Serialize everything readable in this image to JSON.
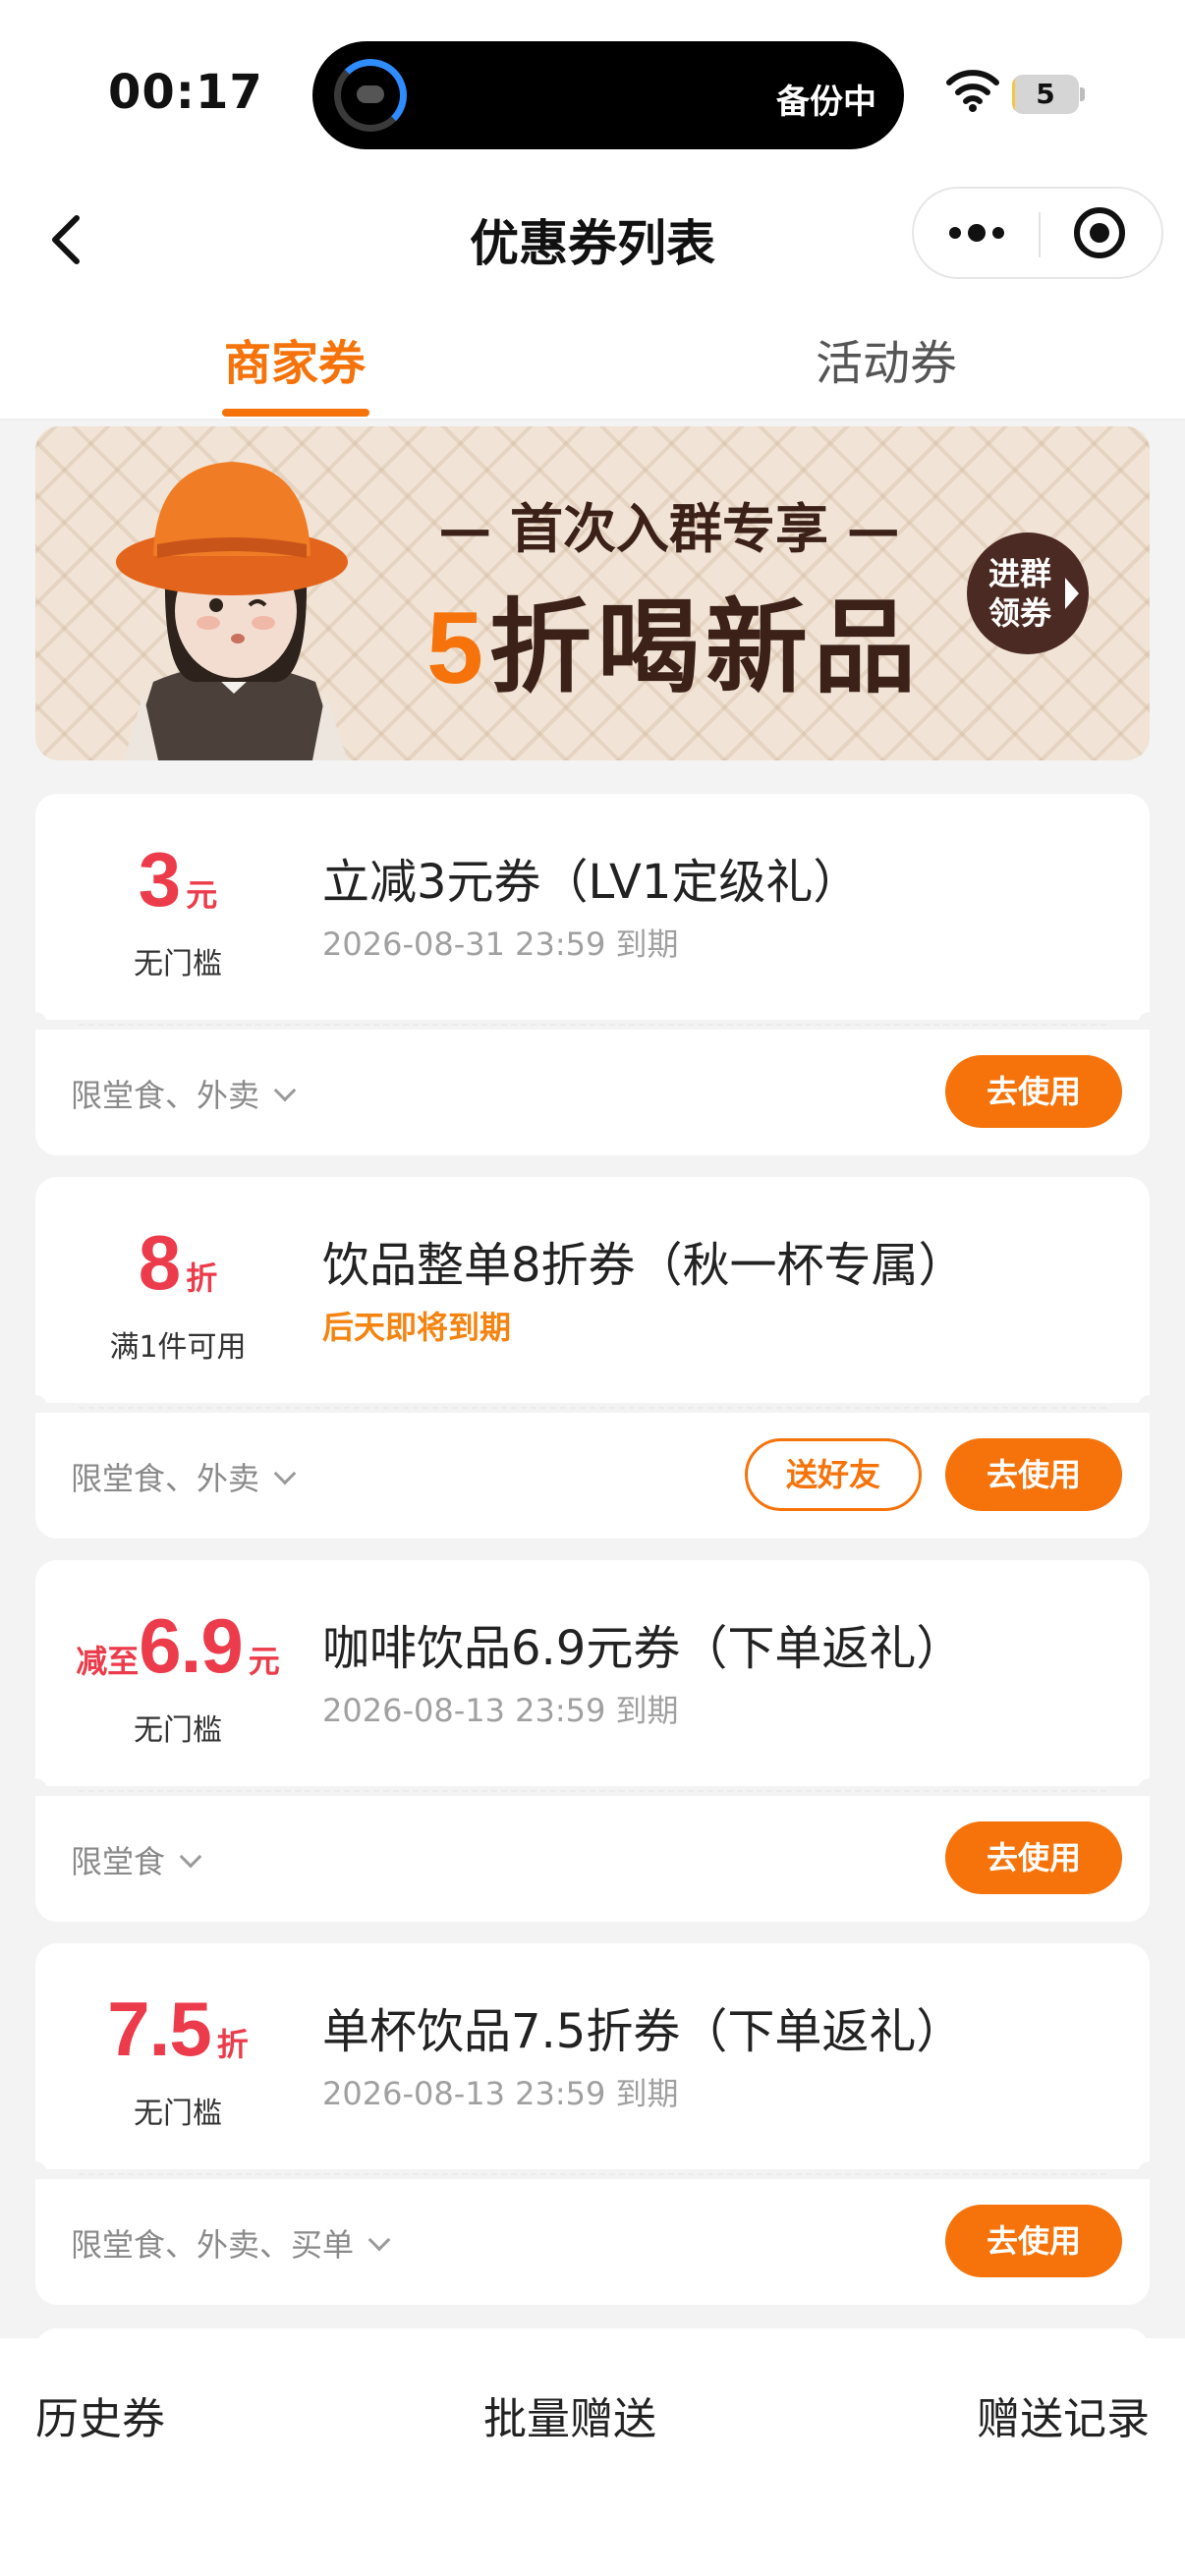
{
  "status_bar": {
    "time": "00:17",
    "island_text": "备份中",
    "battery_level": 5,
    "battery_percent": 0.05
  },
  "nav": {
    "title": "优惠券列表",
    "icons": {
      "back": "chevron-left-icon",
      "more": "more-dots-icon",
      "close": "target-circle-icon"
    }
  },
  "tabs": [
    {
      "label": "商家券",
      "active": true
    },
    {
      "label": "活动券",
      "active": false
    }
  ],
  "banner": {
    "subtitle": "— 首次入群专享 —",
    "title_num": "5",
    "title_rest": "折喝新品",
    "join_button": "进群领券"
  },
  "coupons": [
    {
      "value_prefix": "",
      "value": "3",
      "unit": "元",
      "threshold": "无门槛",
      "title": "立减3元券（LV1定级礼）",
      "expiry": "2026-08-31 23:59 到期",
      "expiry_warn": false,
      "scope": "限堂食、外卖",
      "gift_button": "",
      "use_button": "去使用"
    },
    {
      "value_prefix": "",
      "value": "8",
      "unit": "折",
      "threshold": "满1件可用",
      "title": "饮品整单8折券（秋一杯专属）",
      "expiry": "后天即将到期",
      "expiry_warn": true,
      "scope": "限堂食、外卖",
      "gift_button": "送好友",
      "use_button": "去使用"
    },
    {
      "value_prefix": "减至",
      "value": "6.9",
      "unit": "元",
      "threshold": "无门槛",
      "title": "咖啡饮品6.9元券（下单返礼）",
      "expiry": "2026-08-13 23:59 到期",
      "expiry_warn": false,
      "scope": "限堂食",
      "gift_button": "",
      "use_button": "去使用"
    },
    {
      "value_prefix": "",
      "value": "7.5",
      "unit": "折",
      "threshold": "无门槛",
      "title": "单杯饮品7.5折券（下单返礼）",
      "expiry": "2026-08-13 23:59 到期",
      "expiry_warn": false,
      "scope": "限堂食、外卖、买单",
      "gift_button": "",
      "use_button": "去使用"
    }
  ],
  "bottom_bar": {
    "history": "历史券",
    "batch_gift": "批量赠送",
    "gift_records": "赠送记录"
  },
  "colors": {
    "accent": "#f5730a",
    "value_red": "#ec3b4a",
    "warn_orange": "#f5830f",
    "banner_brown": "#3b2118"
  }
}
